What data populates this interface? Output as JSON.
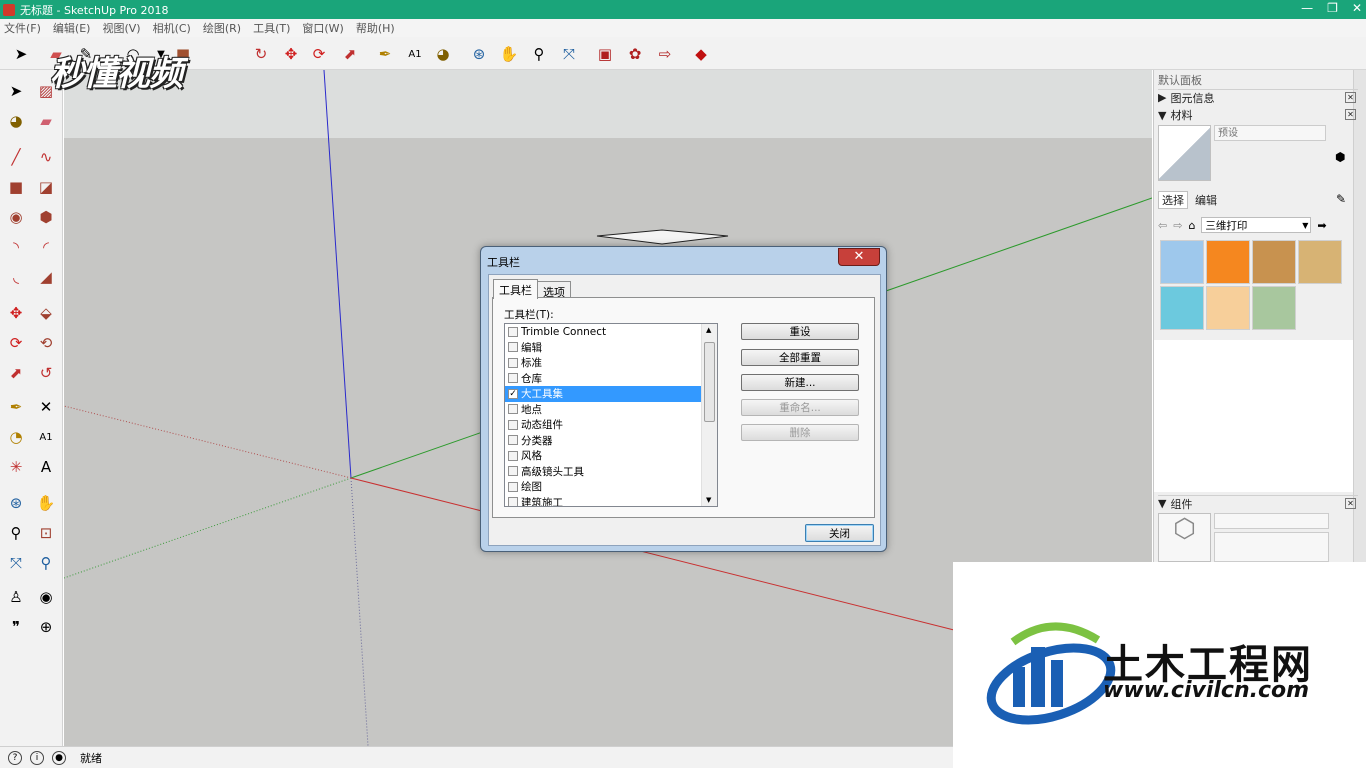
{
  "window": {
    "title": "无标题 - SketchUp Pro 2018"
  },
  "menu": [
    "文件(F)",
    "编辑(E)",
    "视图(V)",
    "相机(C)",
    "绘图(R)",
    "工具(T)",
    "窗口(W)",
    "帮助(H)"
  ],
  "watermark_top": "秒懂视频",
  "right_panel": {
    "tray_title": "默认面板",
    "entity_info": "图元信息",
    "materials": "材料",
    "preset_placeholder": "预设",
    "tab_select": "选择",
    "tab_edit": "编辑",
    "library": "三维打印",
    "components": "组件",
    "swatch_colors": [
      "#9ec8ec",
      "#f5871f",
      "#c8924f",
      "#d7b374",
      "#6cc9de",
      "#f7cf9a",
      "#a8c79e"
    ]
  },
  "status": {
    "text": "就绪"
  },
  "dialog": {
    "title": "工具栏",
    "close_symbol": "✕",
    "tabs": [
      "工具栏",
      "选项"
    ],
    "list_label": "工具栏(T):",
    "items": [
      {
        "label": "Trimble Connect",
        "checked": false,
        "selected": false
      },
      {
        "label": "编辑",
        "checked": false,
        "selected": false
      },
      {
        "label": "标准",
        "checked": false,
        "selected": false
      },
      {
        "label": "仓库",
        "checked": false,
        "selected": false
      },
      {
        "label": "大工具集",
        "checked": true,
        "selected": true
      },
      {
        "label": "地点",
        "checked": false,
        "selected": false
      },
      {
        "label": "动态组件",
        "checked": false,
        "selected": false
      },
      {
        "label": "分类器",
        "checked": false,
        "selected": false
      },
      {
        "label": "风格",
        "checked": false,
        "selected": false
      },
      {
        "label": "高级镜头工具",
        "checked": false,
        "selected": false
      },
      {
        "label": "绘图",
        "checked": false,
        "selected": false
      },
      {
        "label": "建筑施工",
        "checked": false,
        "selected": false
      }
    ],
    "buttons": {
      "reset": "重设",
      "reset_all": "全部重置",
      "new": "新建...",
      "rename": "重命名...",
      "delete": "删除",
      "close": "关闭"
    }
  },
  "logo": {
    "cn": "土木工程网",
    "url": "www.civilcn.com"
  }
}
